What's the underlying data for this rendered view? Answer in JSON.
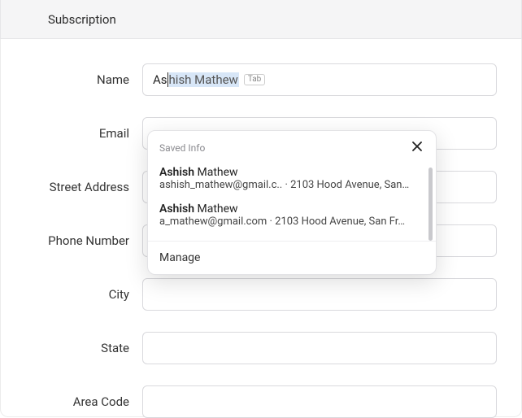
{
  "header": {
    "title": "Subscription"
  },
  "labels": {
    "name": "Name",
    "email": "Email",
    "street": "Street Address",
    "phone": "Phone Number",
    "city": "City",
    "state": "State",
    "area": "Area Code"
  },
  "name_field": {
    "typed": "As",
    "suggest_rest": "hish Mathew",
    "tab_hint": "Tab"
  },
  "values": {
    "email": "",
    "street": "",
    "phone": "",
    "city": "",
    "state": "",
    "area": ""
  },
  "autofill": {
    "heading": "Saved Info",
    "manage": "Manage",
    "items": [
      {
        "name_bold": "Ashish",
        "name_rest": " Mathew",
        "detail": "ashish_mathew@gmail.c.. · 2103 Hood Avenue, San…"
      },
      {
        "name_bold": "Ashish",
        "name_rest": " Mathew",
        "detail": "a_mathew@gmail.com · 2103 Hood Avenue, San Fr…"
      }
    ]
  }
}
